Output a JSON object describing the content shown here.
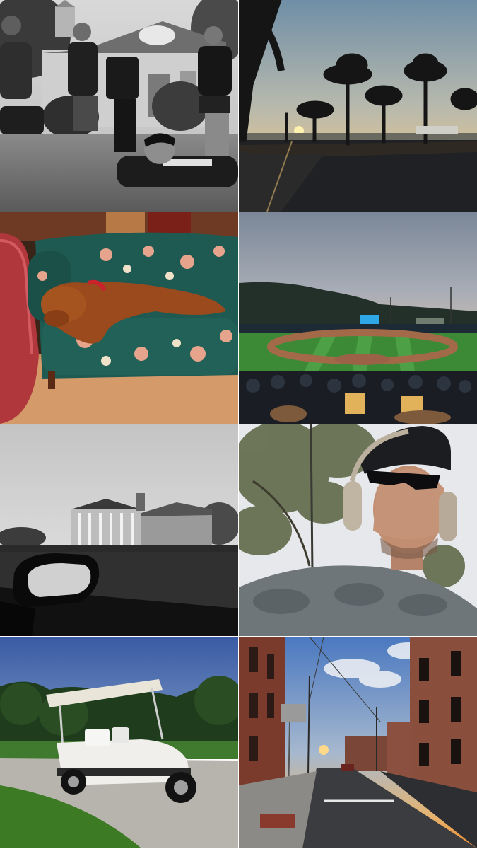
{
  "collage": {
    "columns": 2,
    "rows": 4,
    "photos": [
      {
        "subject": "film-crew-on-lawn",
        "style": "black-and-white"
      },
      {
        "subject": "palm-tree-sunset",
        "style": "color"
      },
      {
        "subject": "dog-on-floral-sofa",
        "style": "color"
      },
      {
        "subject": "night-baseball-game",
        "style": "color"
      },
      {
        "subject": "mansion-side-mirror",
        "style": "black-and-white"
      },
      {
        "subject": "selfie-headphones",
        "style": "color"
      },
      {
        "subject": "white-golf-cart",
        "style": "color"
      },
      {
        "subject": "brick-street-sunset",
        "style": "color"
      }
    ]
  }
}
